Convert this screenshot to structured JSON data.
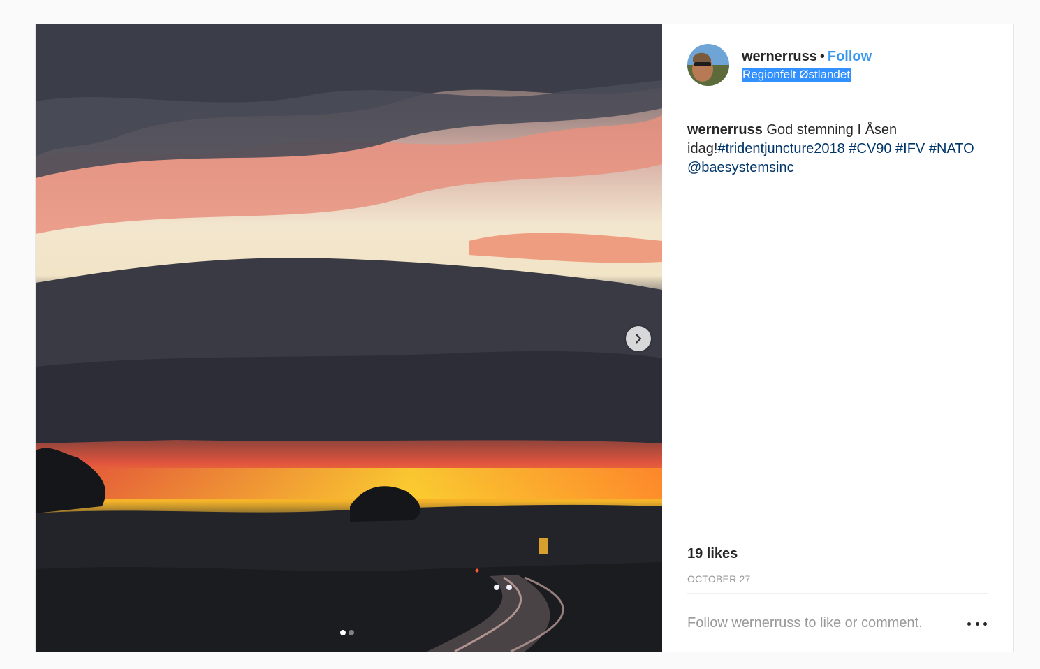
{
  "post": {
    "author": {
      "username": "wernerruss",
      "separator": "•",
      "follow_label": "Follow",
      "location": "Regionfelt Østlandet"
    },
    "caption": {
      "username": "wernerruss",
      "text": "God stemning I Åsen idag!",
      "hashtags": [
        "#tridentjuncture2018",
        "#CV90",
        "#IFV",
        "#NATO"
      ],
      "mention": "@baesystemsinc"
    },
    "likes_label": "19 likes",
    "date": "OCTOBER 27",
    "comment_prompt": "Follow wernerruss to like or comment.",
    "carousel": {
      "slide_count": 2,
      "active_slide": 1
    }
  },
  "colors": {
    "link": "#3897f0",
    "hashtag": "#003569",
    "muted": "#999999",
    "selection_highlight": "#3390ff"
  },
  "icons": [
    "chevron-right-icon",
    "more-options-icon"
  ]
}
